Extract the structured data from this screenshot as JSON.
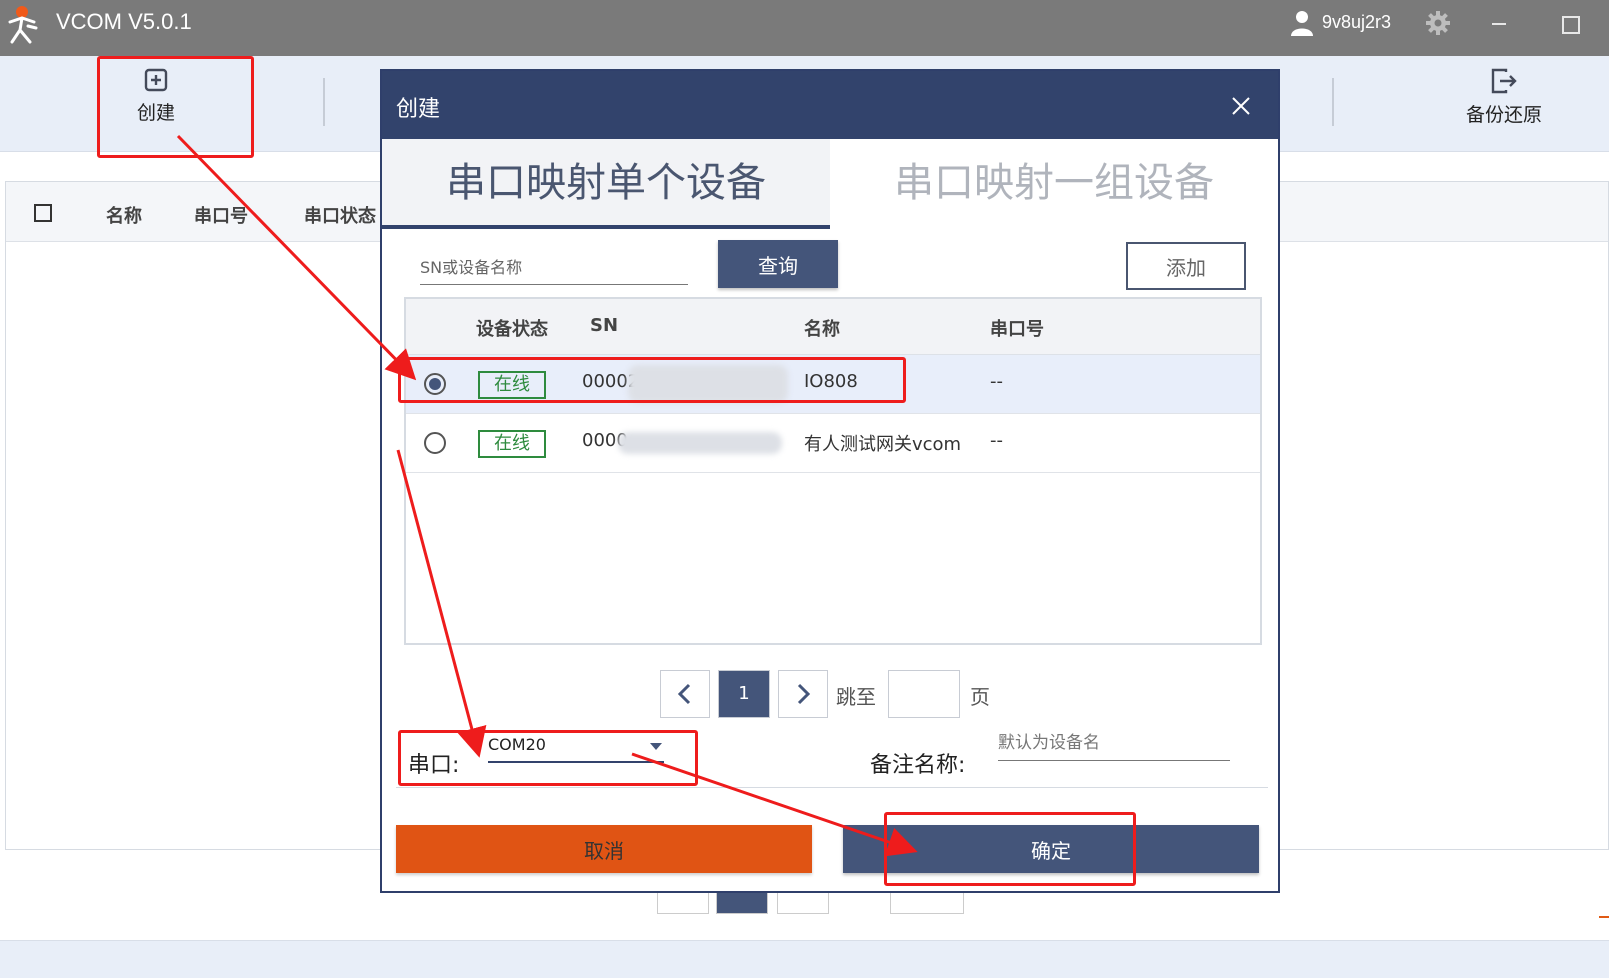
{
  "titlebar": {
    "title": "VCOM V5.0.1",
    "user": "9v8uj2r3",
    "logo_icon": "runner-logo-icon",
    "user_icon": "user-icon",
    "settings_icon": "gear-icon"
  },
  "toolbar": {
    "create_label": "创建",
    "create_icon": "plus-square-icon",
    "backup_label": "备份还原",
    "backup_icon": "export-icon"
  },
  "list": {
    "columns": [
      "名称",
      "串口号",
      "串口状态"
    ]
  },
  "dialog": {
    "title": "创建",
    "tabs": [
      "串口映射单个设备",
      "串口映射一组设备"
    ],
    "active_tab": 0,
    "search_placeholder": "SN或设备名称",
    "query_label": "查询",
    "add_label": "添加",
    "table": {
      "headers": [
        "设备状态",
        "SN",
        "名称",
        "串口号"
      ],
      "rows": [
        {
          "selected": true,
          "status": "在线",
          "sn": "00002",
          "name": "IO808",
          "port": "--"
        },
        {
          "selected": false,
          "status": "在线",
          "sn": "0000",
          "name": "有人测试网关vcom",
          "port": "--"
        }
      ]
    },
    "pagination": {
      "current": "1",
      "jump_label": "跳至",
      "page_suffix": "页"
    },
    "port_label": "串口:",
    "port_value": "COM20",
    "remark_label": "备注名称:",
    "remark_placeholder": "默认为设备名",
    "cancel_label": "取消",
    "ok_label": "确定"
  },
  "colors": {
    "header": "#32436c",
    "primary": "#44557a",
    "cancel": "#e05414",
    "online": "#2e8b3e",
    "annotation": "#ee1c1c"
  }
}
